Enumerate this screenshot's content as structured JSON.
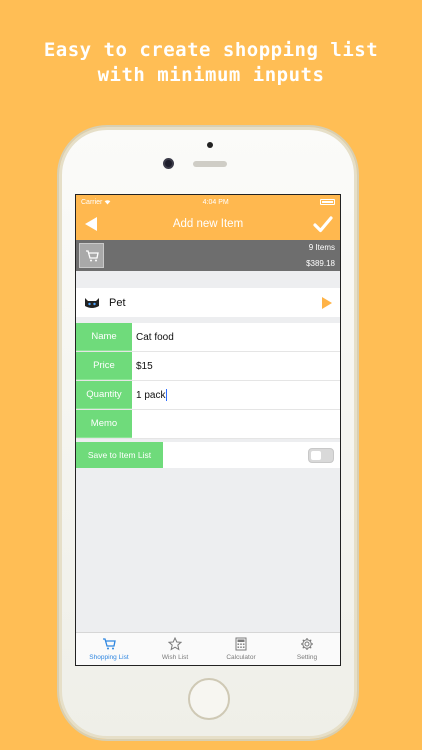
{
  "headline": {
    "line1": "Easy to create shopping list",
    "line2": "with minimum inputs"
  },
  "status_bar": {
    "carrier": "Carrier",
    "time": "4:04 PM"
  },
  "nav": {
    "title": "Add new Item",
    "back_icon": "back-arrow-icon",
    "confirm_icon": "checkmark-icon"
  },
  "summary": {
    "count": "9 Items",
    "total": "$389.18"
  },
  "category": {
    "icon": "cat-icon",
    "label": "Pet"
  },
  "form": {
    "rows": [
      {
        "label": "Name",
        "value": "Cat food"
      },
      {
        "label": "Price",
        "value": "$15"
      },
      {
        "label": "Quantity",
        "value": "1 pack"
      },
      {
        "label": "Memo",
        "value": ""
      }
    ]
  },
  "save": {
    "label": "Save to Item List",
    "toggle_on": false
  },
  "tabs": [
    {
      "label": "Shopping List",
      "icon": "cart-icon",
      "active": true
    },
    {
      "label": "Wish List",
      "icon": "star-icon",
      "active": false
    },
    {
      "label": "Calculator",
      "icon": "calculator-icon",
      "active": false
    },
    {
      "label": "Setting",
      "icon": "gear-icon",
      "active": false
    }
  ],
  "colors": {
    "background": "#FFBE55",
    "navbar": "#FFB84F",
    "label_green": "#6FDB7B",
    "summary_gray": "#6E6E6E",
    "active_tab": "#2F86E0"
  }
}
